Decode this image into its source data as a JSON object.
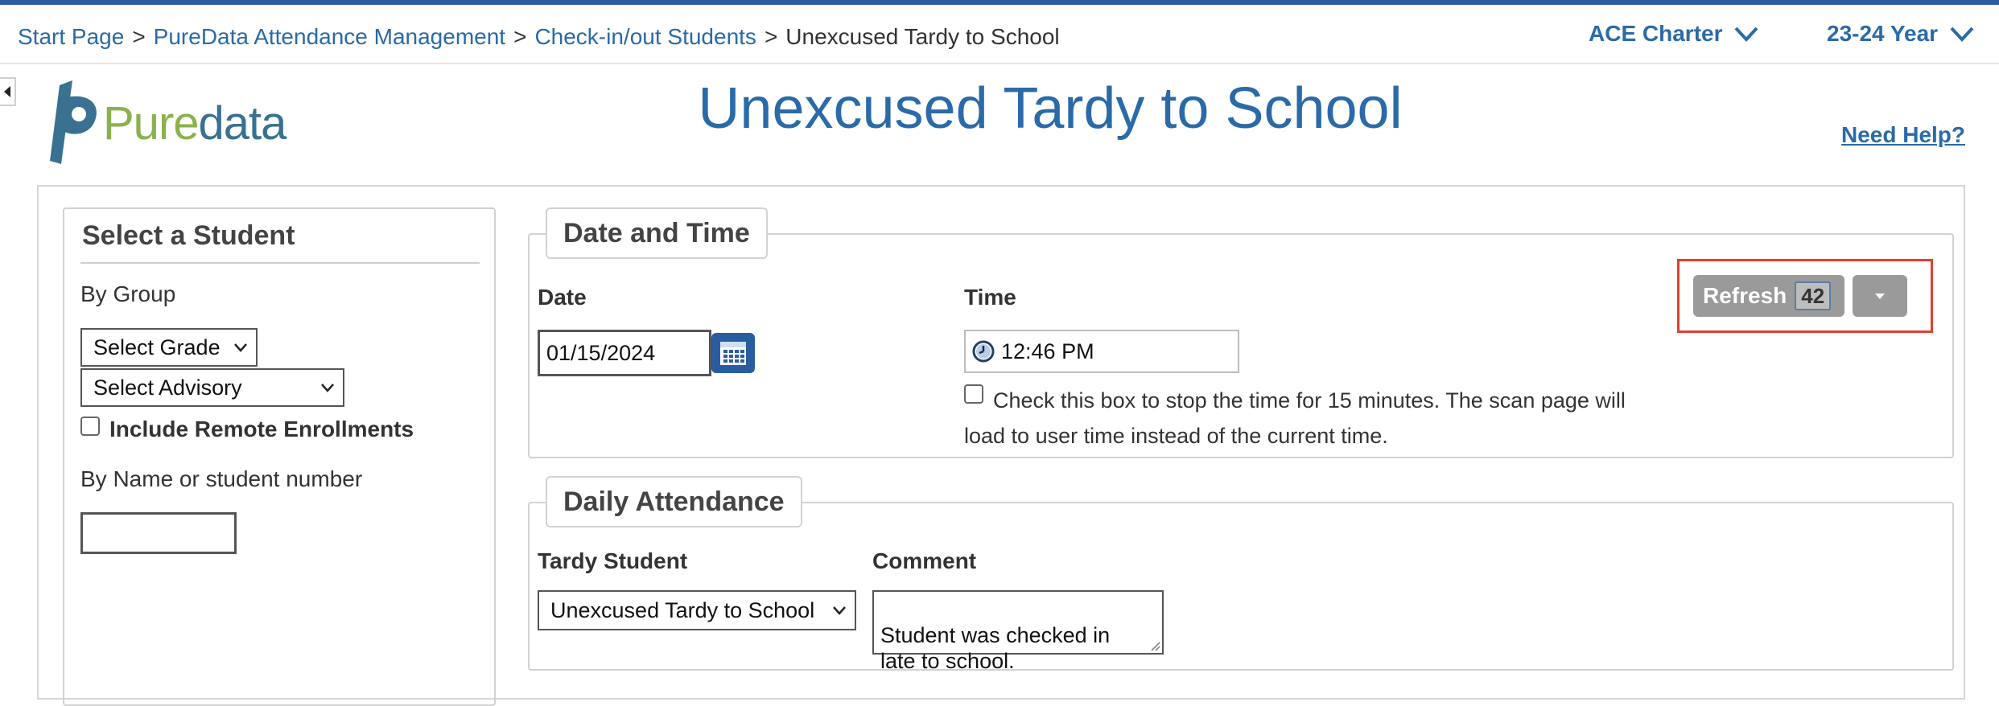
{
  "breadcrumb": {
    "items": [
      "Start Page",
      "PureData Attendance Management",
      "Check-in/out Students"
    ],
    "current": "Unexcused Tardy to School",
    "separator": ">"
  },
  "header": {
    "school_select": "ACE Charter",
    "year_select": "23-24 Year",
    "logo": {
      "part1": "Pure",
      "part2": "data"
    },
    "title": "Unexcused Tardy to School",
    "help_link": "Need Help?"
  },
  "student_panel": {
    "title": "Select a Student",
    "by_group_label": "By Group",
    "grade_select": "Select Grade",
    "advisory_select": "Select Advisory",
    "remote_label": "Include Remote Enrollments",
    "remote_checked": false,
    "by_name_label": "By Name or student number",
    "name_input_value": ""
  },
  "date_time": {
    "legend": "Date and Time",
    "date_label": "Date",
    "date_value": "01/15/2024",
    "time_label": "Time",
    "time_value": "12:46 PM",
    "stop_time_checked": false,
    "stop_time_text": "Check this box to stop the time for 15 minutes. The scan page will load to user time instead of the current time.",
    "refresh_label": "Refresh",
    "refresh_count": "42"
  },
  "daily_attendance": {
    "legend": "Daily Attendance",
    "tardy_label": "Tardy Student",
    "tardy_select": "Unexcused Tardy to School",
    "comment_label": "Comment",
    "comment_value": "Student was checked in\nlate to school."
  },
  "colors": {
    "brand_blue": "#2a6aa8",
    "logo_green": "#8bb14d",
    "logo_teal": "#3a7191",
    "highlight_red": "#e0402f"
  },
  "icons": [
    "chevron-down-icon",
    "collapse-left-icon",
    "calendar-icon",
    "clock-icon",
    "caret-down-icon",
    "resize-grip-icon"
  ]
}
